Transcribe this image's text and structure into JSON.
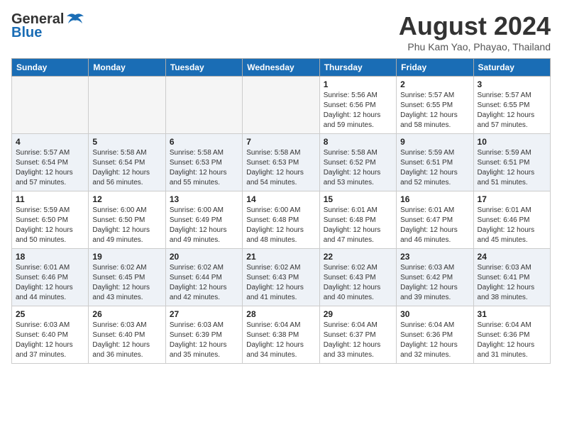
{
  "header": {
    "logo_general": "General",
    "logo_blue": "Blue",
    "month_year": "August 2024",
    "location": "Phu Kam Yao, Phayao, Thailand"
  },
  "weekdays": [
    "Sunday",
    "Monday",
    "Tuesday",
    "Wednesday",
    "Thursday",
    "Friday",
    "Saturday"
  ],
  "weeks": [
    [
      {
        "day": "",
        "info": ""
      },
      {
        "day": "",
        "info": ""
      },
      {
        "day": "",
        "info": ""
      },
      {
        "day": "",
        "info": ""
      },
      {
        "day": "1",
        "info": "Sunrise: 5:56 AM\nSunset: 6:56 PM\nDaylight: 12 hours\nand 59 minutes."
      },
      {
        "day": "2",
        "info": "Sunrise: 5:57 AM\nSunset: 6:55 PM\nDaylight: 12 hours\nand 58 minutes."
      },
      {
        "day": "3",
        "info": "Sunrise: 5:57 AM\nSunset: 6:55 PM\nDaylight: 12 hours\nand 57 minutes."
      }
    ],
    [
      {
        "day": "4",
        "info": "Sunrise: 5:57 AM\nSunset: 6:54 PM\nDaylight: 12 hours\nand 57 minutes."
      },
      {
        "day": "5",
        "info": "Sunrise: 5:58 AM\nSunset: 6:54 PM\nDaylight: 12 hours\nand 56 minutes."
      },
      {
        "day": "6",
        "info": "Sunrise: 5:58 AM\nSunset: 6:53 PM\nDaylight: 12 hours\nand 55 minutes."
      },
      {
        "day": "7",
        "info": "Sunrise: 5:58 AM\nSunset: 6:53 PM\nDaylight: 12 hours\nand 54 minutes."
      },
      {
        "day": "8",
        "info": "Sunrise: 5:58 AM\nSunset: 6:52 PM\nDaylight: 12 hours\nand 53 minutes."
      },
      {
        "day": "9",
        "info": "Sunrise: 5:59 AM\nSunset: 6:51 PM\nDaylight: 12 hours\nand 52 minutes."
      },
      {
        "day": "10",
        "info": "Sunrise: 5:59 AM\nSunset: 6:51 PM\nDaylight: 12 hours\nand 51 minutes."
      }
    ],
    [
      {
        "day": "11",
        "info": "Sunrise: 5:59 AM\nSunset: 6:50 PM\nDaylight: 12 hours\nand 50 minutes."
      },
      {
        "day": "12",
        "info": "Sunrise: 6:00 AM\nSunset: 6:50 PM\nDaylight: 12 hours\nand 49 minutes."
      },
      {
        "day": "13",
        "info": "Sunrise: 6:00 AM\nSunset: 6:49 PM\nDaylight: 12 hours\nand 49 minutes."
      },
      {
        "day": "14",
        "info": "Sunrise: 6:00 AM\nSunset: 6:48 PM\nDaylight: 12 hours\nand 48 minutes."
      },
      {
        "day": "15",
        "info": "Sunrise: 6:01 AM\nSunset: 6:48 PM\nDaylight: 12 hours\nand 47 minutes."
      },
      {
        "day": "16",
        "info": "Sunrise: 6:01 AM\nSunset: 6:47 PM\nDaylight: 12 hours\nand 46 minutes."
      },
      {
        "day": "17",
        "info": "Sunrise: 6:01 AM\nSunset: 6:46 PM\nDaylight: 12 hours\nand 45 minutes."
      }
    ],
    [
      {
        "day": "18",
        "info": "Sunrise: 6:01 AM\nSunset: 6:46 PM\nDaylight: 12 hours\nand 44 minutes."
      },
      {
        "day": "19",
        "info": "Sunrise: 6:02 AM\nSunset: 6:45 PM\nDaylight: 12 hours\nand 43 minutes."
      },
      {
        "day": "20",
        "info": "Sunrise: 6:02 AM\nSunset: 6:44 PM\nDaylight: 12 hours\nand 42 minutes."
      },
      {
        "day": "21",
        "info": "Sunrise: 6:02 AM\nSunset: 6:43 PM\nDaylight: 12 hours\nand 41 minutes."
      },
      {
        "day": "22",
        "info": "Sunrise: 6:02 AM\nSunset: 6:43 PM\nDaylight: 12 hours\nand 40 minutes."
      },
      {
        "day": "23",
        "info": "Sunrise: 6:03 AM\nSunset: 6:42 PM\nDaylight: 12 hours\nand 39 minutes."
      },
      {
        "day": "24",
        "info": "Sunrise: 6:03 AM\nSunset: 6:41 PM\nDaylight: 12 hours\nand 38 minutes."
      }
    ],
    [
      {
        "day": "25",
        "info": "Sunrise: 6:03 AM\nSunset: 6:40 PM\nDaylight: 12 hours\nand 37 minutes."
      },
      {
        "day": "26",
        "info": "Sunrise: 6:03 AM\nSunset: 6:40 PM\nDaylight: 12 hours\nand 36 minutes."
      },
      {
        "day": "27",
        "info": "Sunrise: 6:03 AM\nSunset: 6:39 PM\nDaylight: 12 hours\nand 35 minutes."
      },
      {
        "day": "28",
        "info": "Sunrise: 6:04 AM\nSunset: 6:38 PM\nDaylight: 12 hours\nand 34 minutes."
      },
      {
        "day": "29",
        "info": "Sunrise: 6:04 AM\nSunset: 6:37 PM\nDaylight: 12 hours\nand 33 minutes."
      },
      {
        "day": "30",
        "info": "Sunrise: 6:04 AM\nSunset: 6:36 PM\nDaylight: 12 hours\nand 32 minutes."
      },
      {
        "day": "31",
        "info": "Sunrise: 6:04 AM\nSunset: 6:36 PM\nDaylight: 12 hours\nand 31 minutes."
      }
    ]
  ]
}
